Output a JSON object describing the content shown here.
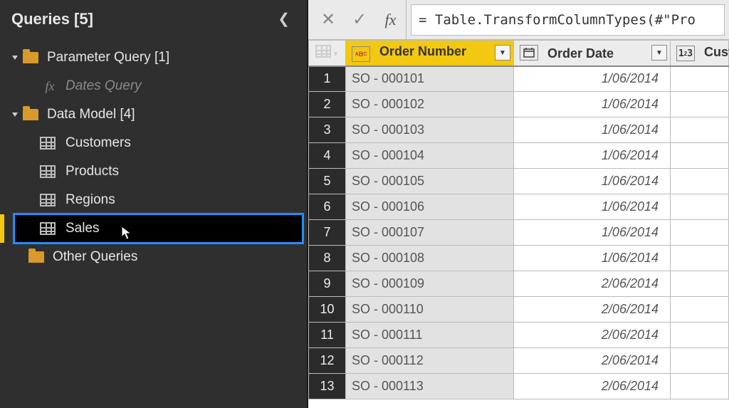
{
  "sidebar": {
    "title": "Queries [5]",
    "groups": [
      {
        "label": "Parameter Query [1]",
        "expanded": true
      },
      {
        "label": "Data Model [4]",
        "expanded": true
      }
    ],
    "datesQuery": "Dates Query",
    "tables": [
      "Customers",
      "Products",
      "Regions",
      "Sales"
    ],
    "selectedTable": "Sales",
    "otherQueries": "Other Queries"
  },
  "formulaBar": {
    "fx": "fx",
    "formula": "= Table.TransformColumnTypes(#\"Pro"
  },
  "columns": [
    {
      "typeIcon": "abc",
      "typeLabel": "ABC",
      "label": "Order Number",
      "selected": true
    },
    {
      "typeIcon": "date",
      "typeLabel": "",
      "label": "Order Date",
      "selected": false
    },
    {
      "typeIcon": "num",
      "typeLabel": "1²3",
      "label": "Custome",
      "selected": false
    }
  ],
  "rows": [
    {
      "n": 1,
      "order": "SO - 000101",
      "date": "1/06/2014"
    },
    {
      "n": 2,
      "order": "SO - 000102",
      "date": "1/06/2014"
    },
    {
      "n": 3,
      "order": "SO - 000103",
      "date": "1/06/2014"
    },
    {
      "n": 4,
      "order": "SO - 000104",
      "date": "1/06/2014"
    },
    {
      "n": 5,
      "order": "SO - 000105",
      "date": "1/06/2014"
    },
    {
      "n": 6,
      "order": "SO - 000106",
      "date": "1/06/2014"
    },
    {
      "n": 7,
      "order": "SO - 000107",
      "date": "1/06/2014"
    },
    {
      "n": 8,
      "order": "SO - 000108",
      "date": "1/06/2014"
    },
    {
      "n": 9,
      "order": "SO - 000109",
      "date": "2/06/2014"
    },
    {
      "n": 10,
      "order": "SO - 000110",
      "date": "2/06/2014"
    },
    {
      "n": 11,
      "order": "SO - 000111",
      "date": "2/06/2014"
    },
    {
      "n": 12,
      "order": "SO - 000112",
      "date": "2/06/2014"
    },
    {
      "n": 13,
      "order": "SO - 000113",
      "date": "2/06/2014"
    }
  ]
}
